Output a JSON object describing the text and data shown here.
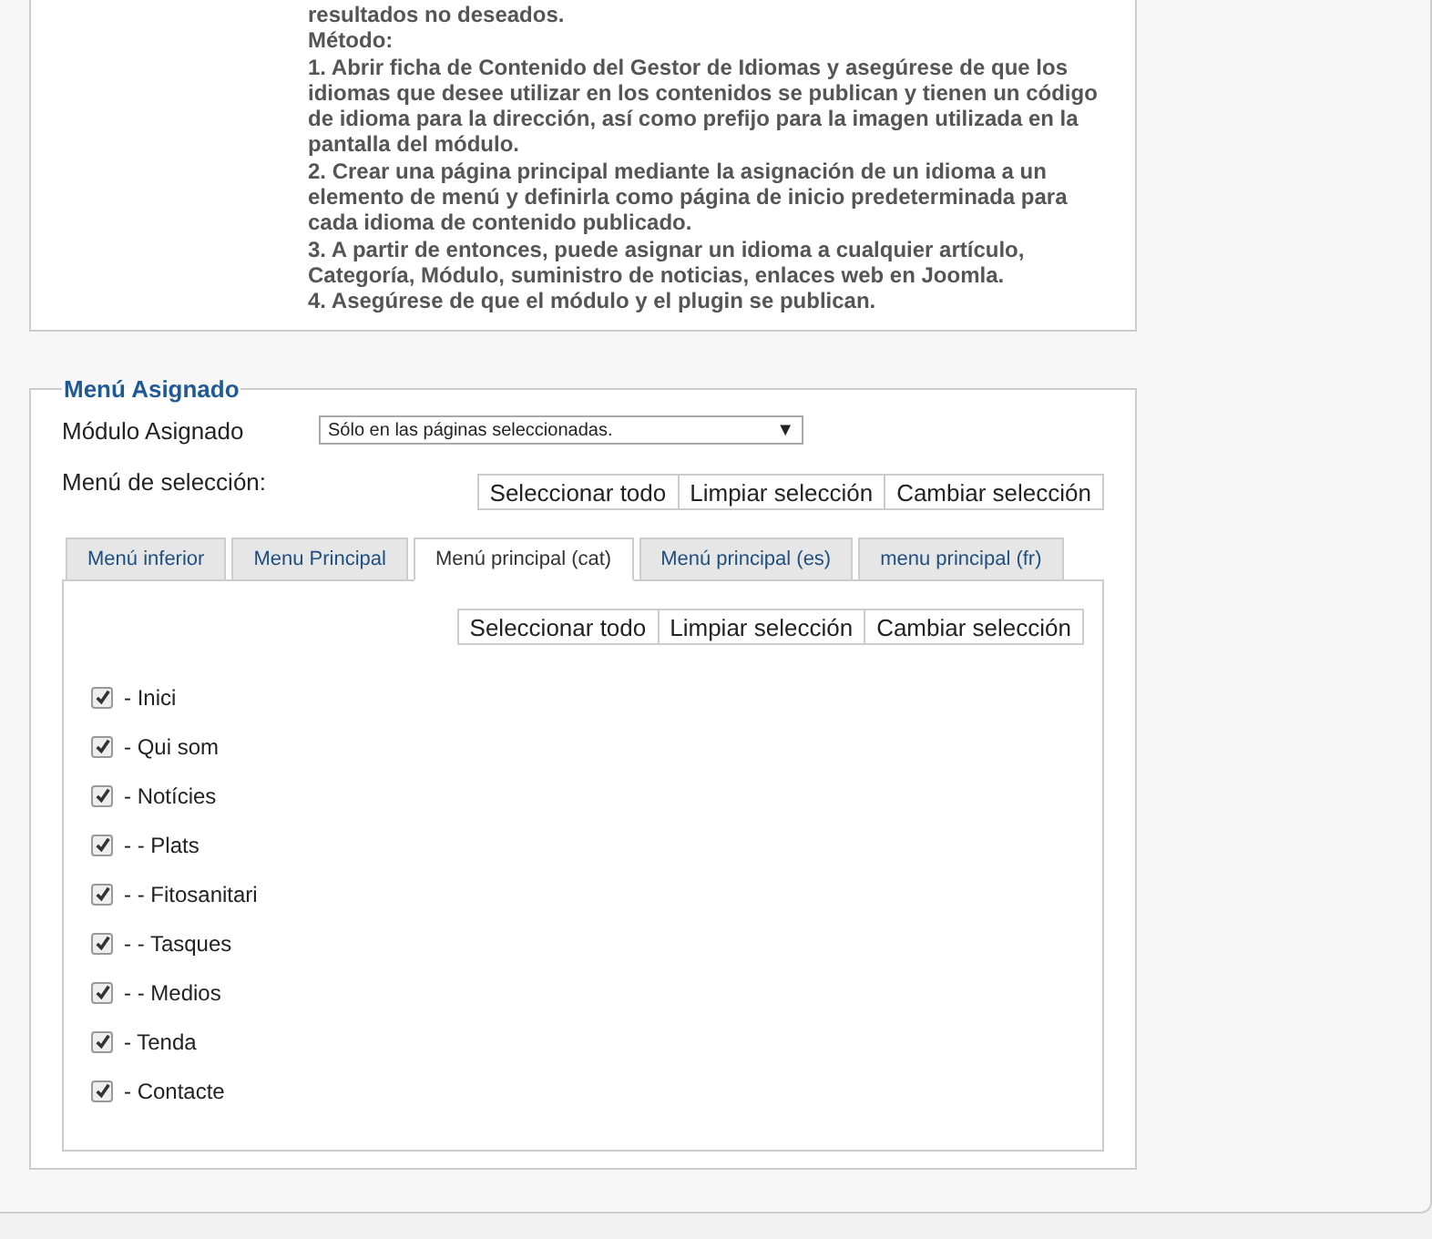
{
  "instructions": [
    "resultados no deseados.",
    "Método:",
    "1. Abrir ficha de Contenido del Gestor de Idiomas y asegúrese de que los idiomas que desee utilizar en los contenidos se publican y tienen un código de idioma para la dirección, así como prefijo para la imagen utilizada en la pantalla del módulo.",
    "2. Crear una página principal mediante la asignación de un idioma a un elemento de menú y definirla como página de inicio predeterminada para cada idioma de contenido publicado.",
    "3. A partir de entonces, puede asignar un idioma a cualquier artículo, Categoría, Módulo, suministro de noticias, enlaces web en Joomla.",
    "4. Asegúrese de que el módulo y el plugin se publican."
  ],
  "menu_assignment": {
    "legend": "Menú Asignado",
    "module_assignment": {
      "label": "Módulo Asignado",
      "value": "Sólo en las páginas seleccionadas.",
      "arrow": "▼"
    },
    "menu_selection": {
      "label": "Menú de selección:",
      "buttons": [
        "Seleccionar todo",
        "Limpiar selección",
        "Cambiar selección"
      ]
    },
    "tabs": [
      {
        "label": "Menú inferior",
        "selected": false
      },
      {
        "label": "Menu Principal",
        "selected": false
      },
      {
        "label": "Menú principal (cat)",
        "selected": true
      },
      {
        "label": "Menú principal (es)",
        "selected": false
      },
      {
        "label": "menu principal (fr)",
        "selected": false
      }
    ],
    "tab_buttons": [
      "Seleccionar todo",
      "Limpiar selección",
      "Cambiar selección"
    ],
    "items": [
      {
        "label": "- Inici",
        "checked": true
      },
      {
        "label": "- Qui som",
        "checked": true
      },
      {
        "label": "- Notícies",
        "checked": true
      },
      {
        "label": "- - Plats",
        "checked": true
      },
      {
        "label": "- - Fitosanitari",
        "checked": true
      },
      {
        "label": "- - Tasques",
        "checked": true
      },
      {
        "label": "- - Medios",
        "checked": true
      },
      {
        "label": "- Tenda",
        "checked": true
      },
      {
        "label": "- Contacte",
        "checked": true
      }
    ]
  }
}
